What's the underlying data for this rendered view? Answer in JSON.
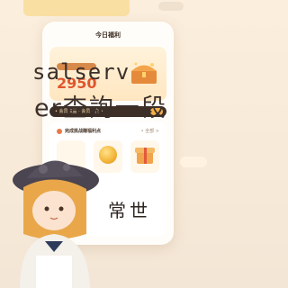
{
  "phone": {
    "title": "今日福利",
    "reward": {
      "amount": "2950",
      "caption": "",
      "unit": ""
    },
    "strip_text": "• 会员权益 · 会员 · 金 •",
    "task_card": {
      "heading": "完成挑战赚福利点",
      "more": "• 全部 >"
    }
  },
  "overlay": {
    "line1": "salserv",
    "line2": "er查詢一段",
    "line3": "常世"
  },
  "colors": {
    "accent": "#e0562e",
    "strip_bg": "#3d2f26",
    "page_bg": "#f8ead8"
  },
  "icons": [
    "treasure-chest-icon",
    "coin-icon",
    "gift-box-icon",
    "mascot-character"
  ]
}
